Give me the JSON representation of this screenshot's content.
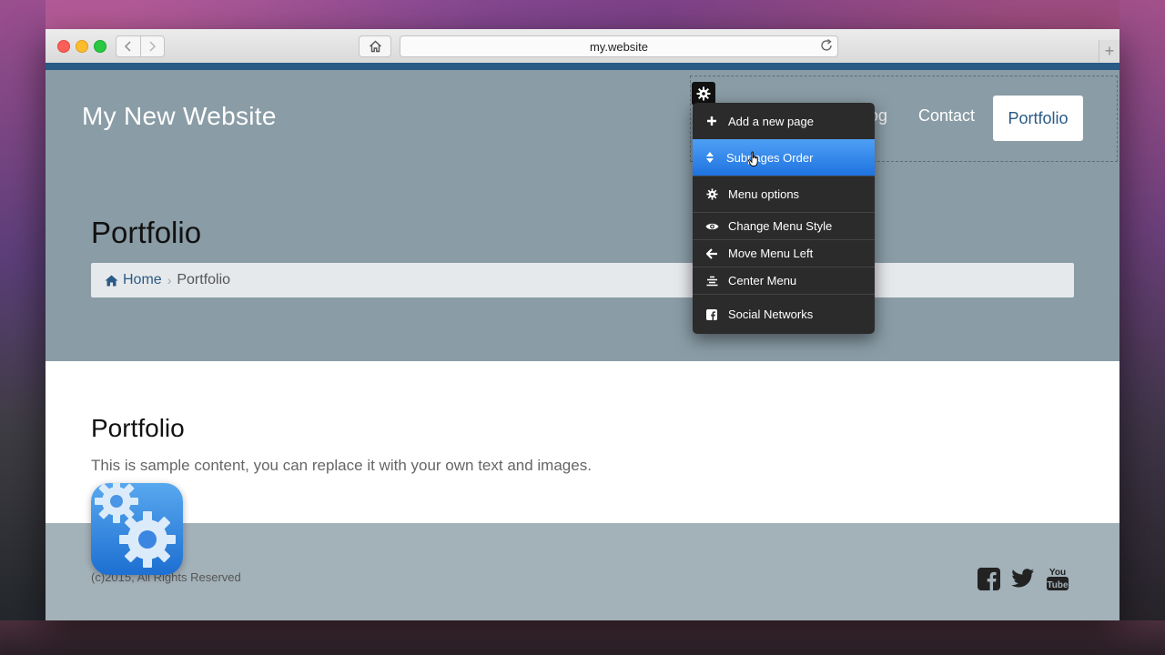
{
  "browser": {
    "url": "my.website",
    "back_icon": "chevron-left-icon",
    "forward_icon": "chevron-right-icon",
    "home_icon": "home-icon",
    "reload_icon": "reload-icon",
    "new_tab_label": "+"
  },
  "site": {
    "brand": "My New Website",
    "nav": {
      "partial_item": "og",
      "contact": "Contact",
      "portfolio": "Portfolio"
    },
    "hero": {
      "title": "Portfolio",
      "breadcrumb": {
        "home": "Home",
        "separator": "›",
        "current": "Portfolio"
      }
    },
    "content": {
      "title": "Portfolio",
      "text": "This is sample content, you can replace it with your own text and images."
    },
    "footer": {
      "copyright": "(c)2015, All Rights Reserved",
      "social": [
        "facebook-icon",
        "twitter-icon",
        "youtube-icon"
      ],
      "youtube_line1": "You",
      "youtube_line2": "Tube"
    }
  },
  "menu": {
    "items": [
      {
        "label": "Add a new page",
        "icon": "plus-icon"
      },
      {
        "label": "Subpages Order",
        "icon": "sort-icon",
        "active": true
      },
      {
        "label": "Menu options",
        "icon": "gear-icon"
      },
      {
        "label": "Change Menu Style",
        "icon": "eye-icon"
      },
      {
        "label": "Move Menu Left",
        "icon": "arrow-left-icon"
      },
      {
        "label": "Center Menu",
        "icon": "align-center-icon"
      },
      {
        "label": "Social Networks",
        "icon": "facebook-icon"
      }
    ]
  },
  "colors": {
    "accent": "#2a5a86",
    "hero_bg": "#8a9ca6",
    "menu_bg": "#2b2b2b",
    "menu_active": "#2f86ea",
    "footer_bg": "#a3b1b9"
  }
}
